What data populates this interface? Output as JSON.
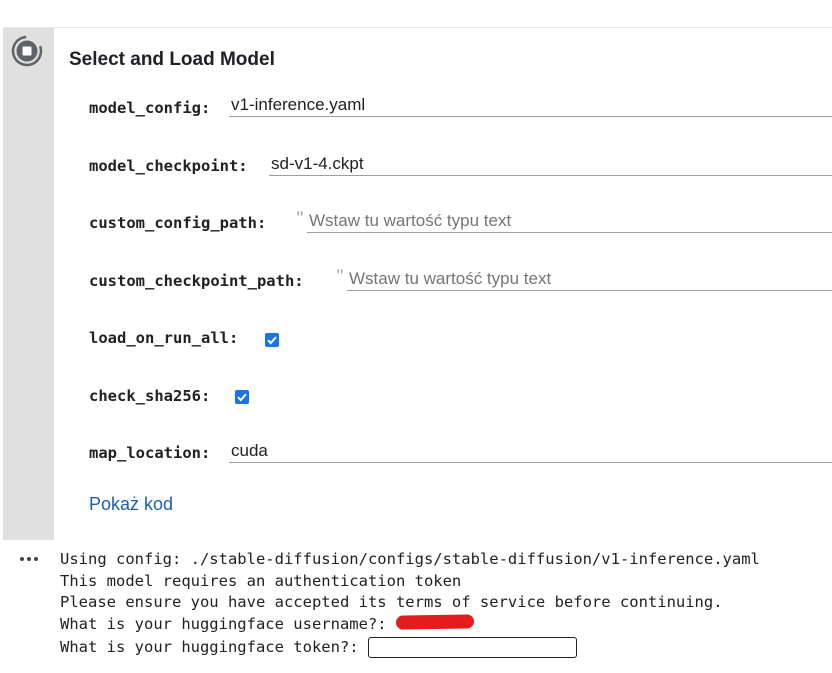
{
  "form": {
    "title": "Select and Load Model",
    "fields": [
      {
        "label": "model_config:",
        "value": "v1-inference.yaml",
        "placeholder": ""
      },
      {
        "label": "model_checkpoint:",
        "value": "sd-v1-4.ckpt",
        "placeholder": ""
      },
      {
        "label": "custom_config_path:",
        "value": "",
        "placeholder": "Wstaw tu wartość typu text"
      },
      {
        "label": "custom_checkpoint_path:",
        "value": "",
        "placeholder": "Wstaw tu wartość typu text"
      },
      {
        "label": "load_on_run_all:",
        "checked": true
      },
      {
        "label": "check_sha256:",
        "checked": true
      },
      {
        "label": "map_location:",
        "value": "cuda",
        "placeholder": ""
      }
    ],
    "quote_glyph": "\"",
    "show_code_label": "Pokaż kod"
  },
  "output": {
    "lines": [
      "Using config: ./stable-diffusion/configs/stable-diffusion/v1-inference.yaml",
      "This model requires an authentication token",
      "Please ensure you have accepted its terms of service before continuing.",
      "What is your huggingface username?:",
      "What is your huggingface token?:"
    ],
    "username_redacted": true,
    "token_value": ""
  },
  "colors": {
    "gutter": "#e0e0e0",
    "checkbox": "#1a73e8",
    "link": "#1a5fb4",
    "redaction": "#e51c1c"
  },
  "icons": {
    "run": "run-cell-icon",
    "output_menu": "more-horiz-icon"
  }
}
